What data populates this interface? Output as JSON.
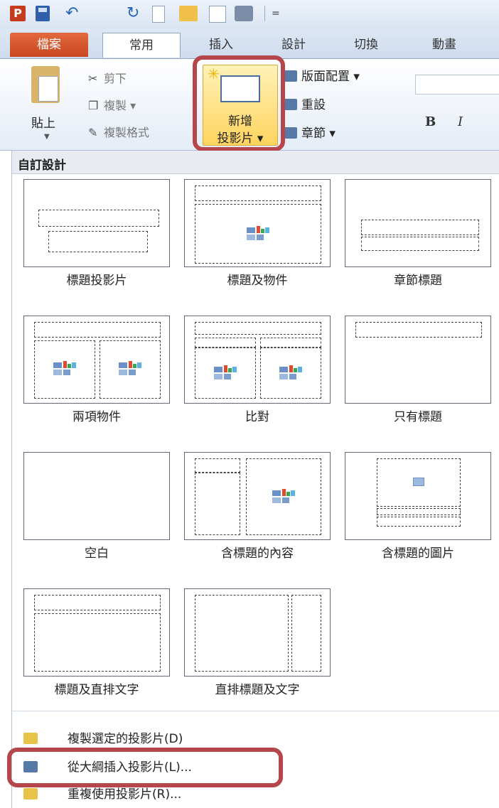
{
  "qat": {
    "logo": "P",
    "more": "="
  },
  "tabs": [
    {
      "label": "檔案"
    },
    {
      "label": "常用"
    },
    {
      "label": "插入"
    },
    {
      "label": "設計"
    },
    {
      "label": "切換"
    },
    {
      "label": "動畫"
    }
  ],
  "clipboard": {
    "paste": "貼上",
    "cut": "剪下",
    "copy": "複製",
    "format_painter": "複製格式"
  },
  "slides": {
    "new_slide_line1": "新增",
    "new_slide_line2": "投影片",
    "layout": "版面配置",
    "reset": "重設",
    "section": "章節"
  },
  "font": {
    "bold": "B",
    "italic": "I"
  },
  "gallery": {
    "title": "自訂設計",
    "layouts": [
      {
        "name": "標題投影片"
      },
      {
        "name": "標題及物件"
      },
      {
        "name": "章節標題"
      },
      {
        "name": "兩項物件"
      },
      {
        "name": "比對"
      },
      {
        "name": "只有標題"
      },
      {
        "name": "空白"
      },
      {
        "name": "含標題的內容"
      },
      {
        "name": "含標題的圖片"
      },
      {
        "name": "標題及直排文字"
      },
      {
        "name": "直排標題及文字"
      }
    ]
  },
  "menu": [
    {
      "label": "複製選定的投影片(D)"
    },
    {
      "label": "從大綱插入投影片(L)..."
    },
    {
      "label": "重複使用投影片(R)..."
    }
  ],
  "colors": {
    "highlight": "#b5474c",
    "file_tab": "#c9461e",
    "accent": "#2e5fa8"
  }
}
